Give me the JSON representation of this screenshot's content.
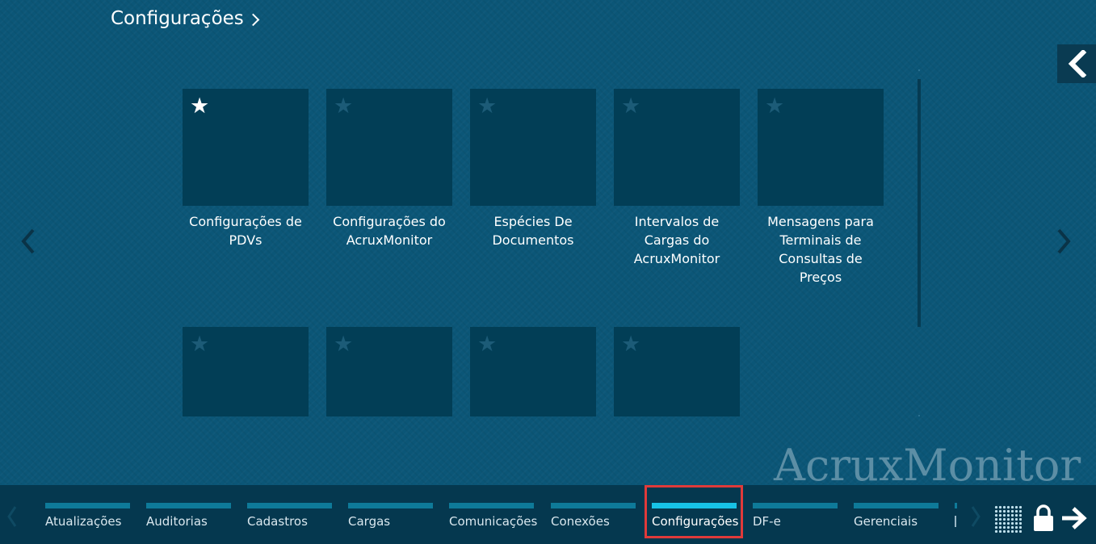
{
  "breadcrumb": {
    "title": "Configurações",
    "icon": "chevron-right-icon"
  },
  "tiles": [
    {
      "label": "Configurações de PDVs",
      "favorite": true
    },
    {
      "label": "Configurações do AcruxMonitor",
      "favorite": false
    },
    {
      "label": "Espécies De Documentos",
      "favorite": false
    },
    {
      "label": "Intervalos de Cargas do AcruxMonitor",
      "favorite": false
    },
    {
      "label": "Mensagens para Terminais de Consultas de Preços",
      "favorite": false
    },
    {
      "label": "",
      "favorite": false
    },
    {
      "label": "",
      "favorite": false
    },
    {
      "label": "",
      "favorite": false
    },
    {
      "label": "",
      "favorite": false
    }
  ],
  "watermark": "AcruxMonitor",
  "bottom_tabs": [
    {
      "label": "Atualizações"
    },
    {
      "label": "Auditorias"
    },
    {
      "label": "Cadastros"
    },
    {
      "label": "Cargas"
    },
    {
      "label": "Comunicações"
    },
    {
      "label": "Conexões"
    },
    {
      "label": "Configurações",
      "active": true
    },
    {
      "label": "DF-e"
    },
    {
      "label": "Gerenciais"
    }
  ],
  "colors": {
    "background": "#0b5677",
    "tile": "#023e56",
    "bottom_bar": "#05384f",
    "tab_bar": "#0e7a99",
    "tab_bar_active": "#17c2e6",
    "highlight": "#e03a3a"
  },
  "icons": [
    "star-icon",
    "chevron-left-icon",
    "chevron-right-icon",
    "grid-icon",
    "lock-icon",
    "arrow-right-icon"
  ]
}
